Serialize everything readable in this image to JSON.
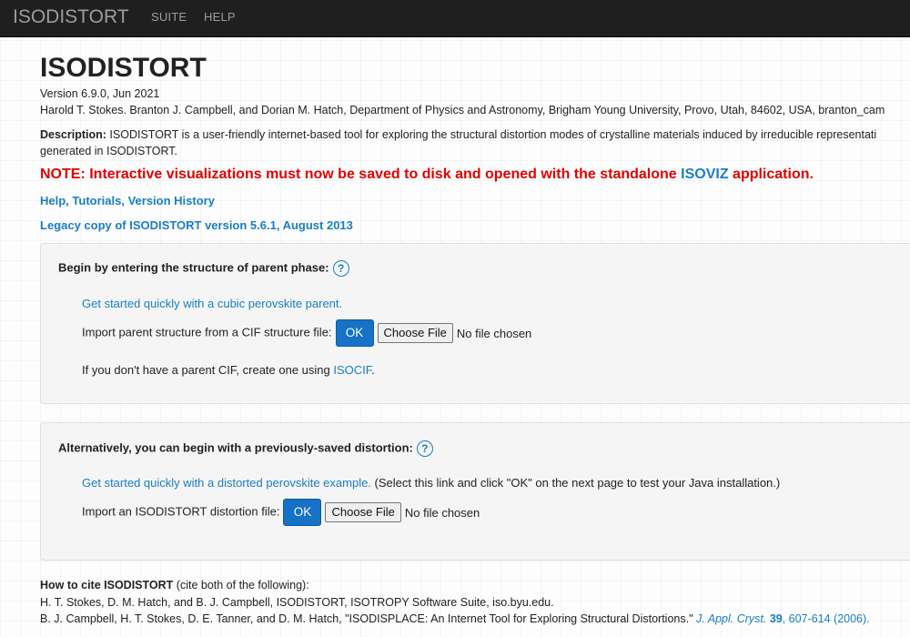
{
  "navbar": {
    "brand": "ISODISTORT",
    "links": [
      "SUITE",
      "HELP"
    ]
  },
  "header": {
    "title": "ISODISTORT",
    "version": "Version 6.9.0, Jun 2021",
    "authors": "Harold T. Stokes. Branton J. Campbell, and Dorian M. Hatch, Department of Physics and Astronomy, Brigham Young University, Provo, Utah, 84602, USA, branton_cam",
    "description_label": "Description:",
    "description_text": " ISODISTORT is a user-friendly internet-based tool for exploring the structural distortion modes of crystalline materials induced by irreducible representati",
    "description_line2": "generated in ISODISTORT.",
    "note_prefix": "NOTE: Interactive visualizations must now be saved to disk and opened with the standalone ",
    "note_link": "ISOVIZ",
    "note_suffix": " application.",
    "help_links": [
      "Help",
      "Tutorials",
      "Version History"
    ],
    "legacy_link": "Legacy copy of ISODISTORT version 5.6.1, August 2013"
  },
  "parent_panel": {
    "title": "Begin by entering the structure of parent phase:",
    "help_icon": "?",
    "quick_link": "Get started quickly with a cubic perovskite parent.",
    "import_label": "Import parent structure from a CIF structure file:",
    "ok_label": "OK",
    "choose_file_label": "Choose File",
    "no_file_text": "No file chosen",
    "isocif_prefix": "If you don't have a parent CIF, create one using ",
    "isocif_link": "ISOCIF",
    "isocif_suffix": "."
  },
  "distortion_panel": {
    "title": "Alternatively, you can begin with a previously-saved distortion:",
    "help_icon": "?",
    "quick_link": "Get started quickly with a distorted perovskite example.",
    "quick_note": " (Select this link and click \"OK\" on the next page to test your Java installation.)",
    "import_label": "Import an ISODISTORT distortion file:",
    "ok_label": "OK",
    "choose_file_label": "Choose File",
    "no_file_text": "No file chosen"
  },
  "cite": {
    "heading": "How to cite ISODISTORT",
    "heading_note": " (cite both of the following):",
    "ref1": "H. T. Stokes, D. M. Hatch, and B. J. Campbell, ISODISTORT, ISOTROPY Software Suite, iso.byu.edu.",
    "ref2_text": "B. J. Campbell, H. T. Stokes, D. E. Tanner, and D. M. Hatch, \"ISODISPLACE: An Internet Tool for Exploring Structural Distortions.\" ",
    "ref2_journal": "J. Appl. Cryst.",
    "ref2_volume": " 39",
    "ref2_pages": ", 607-614 (2006)."
  },
  "colors": {
    "accent": "#1a7ec2",
    "note": "#e00000",
    "navbar": "#1f1f1f",
    "button": "#1572c6"
  }
}
